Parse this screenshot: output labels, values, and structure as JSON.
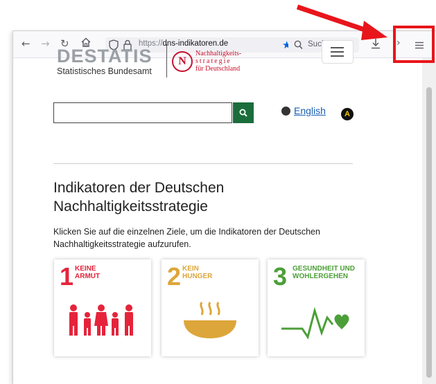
{
  "browser": {
    "url_protocol": "https://",
    "url_host": "dns-indikatoren.de",
    "search_placeholder": "Suchen",
    "icons": [
      "back-icon",
      "forward-icon",
      "reload-icon",
      "home-icon",
      "shield-icon",
      "lock-icon",
      "bookmark-star-icon",
      "search-icon",
      "download-icon",
      "overflow-chevron-icon",
      "menu-icon"
    ]
  },
  "header": {
    "logo_main": "DESTATIS",
    "logo_sub": "Statistisches Bundesamt",
    "nh_letter": "N",
    "nh_lines": [
      "Nachhaltigkeits-",
      "strategie",
      "für Deutschland"
    ]
  },
  "search": {
    "button_icon": "search-icon",
    "language_link": "English",
    "accessibility_badge": "A"
  },
  "main": {
    "title": "Indikatoren der Deutschen Nachhaltigkeitsstrategie",
    "intro": "Klicken Sie auf die einzelnen Ziele, um die Indikatoren der Deutschen Nachhaltigkeitsstrategie aufzurufen."
  },
  "goals": [
    {
      "number": "1",
      "title_line1": "KEINE",
      "title_line2": "ARMUT",
      "color": "#e5243b"
    },
    {
      "number": "2",
      "title_line1": "KEIN",
      "title_line2": "HUNGER",
      "color": "#dda63a"
    },
    {
      "number": "3",
      "title_line1": "GESUNDHEIT UND",
      "title_line2": "WOHLERGEHEN",
      "color": "#4c9f38"
    }
  ],
  "annotation": {
    "color": "#e8151b"
  }
}
